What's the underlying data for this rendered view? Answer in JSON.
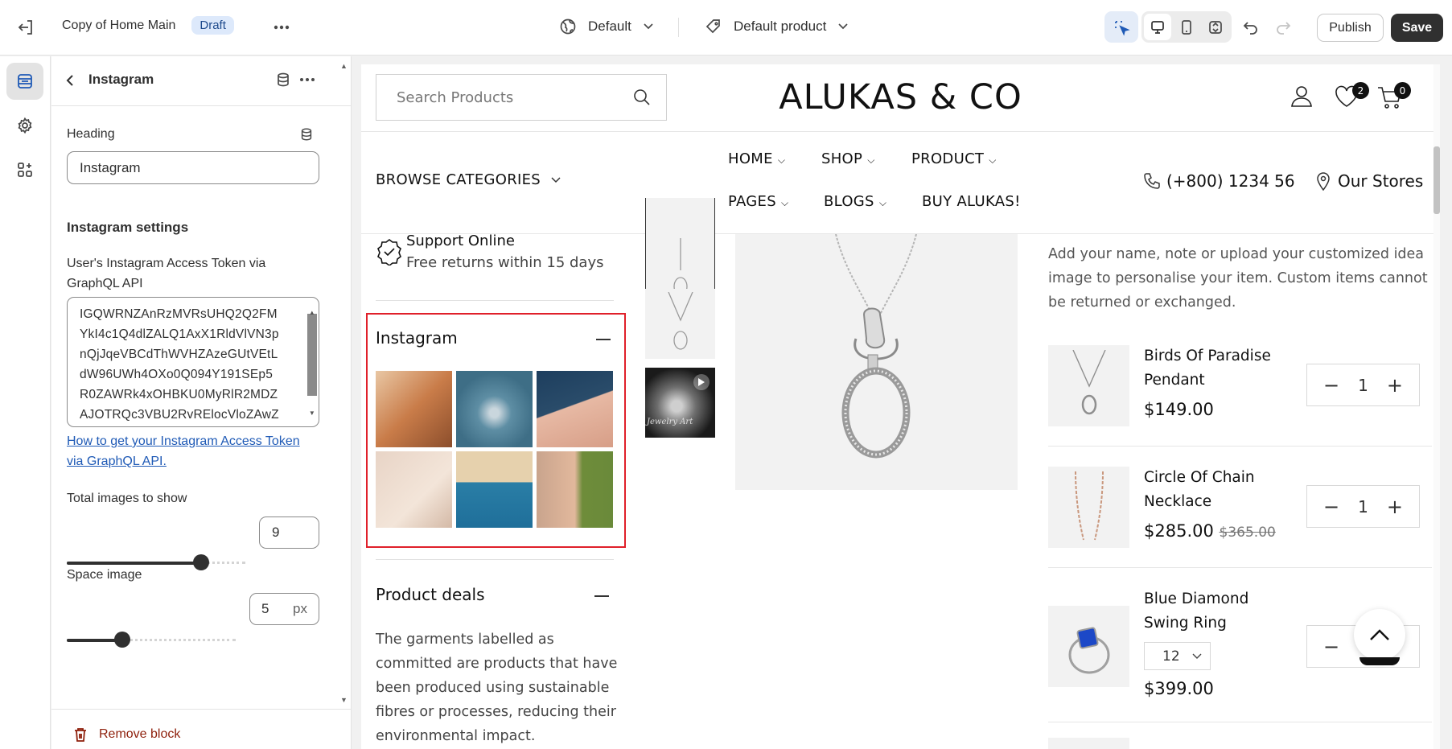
{
  "topbar": {
    "page_name": "Copy of Home Main",
    "status_badge": "Draft",
    "theme_select": "Default",
    "product_select": "Default product",
    "publish_label": "Publish",
    "save_label": "Save"
  },
  "panel": {
    "title": "Instagram",
    "heading_label": "Heading",
    "heading_value": "Instagram",
    "section_title": "Instagram settings",
    "token_label": "User's Instagram Access Token via GraphQL API",
    "token_lines": [
      "IGQWRNZAnRzMVRsUHQ2Q2FM",
      "YkI4c1Q4dlZALQ1AxX1RldVlVN3p",
      "nQjJqeVBCdThWVHZAzeGUtVEtL",
      "dW96UWh4OXo0Q094Y191SEp5",
      "R0ZAWRk4xOHBKU0MyRlR2MDZ",
      "AJOTRQc3VBU2RvRElocVloZAwZ"
    ],
    "token_link": "How to get your Instagram Access Token via GraphQL API.",
    "total_images_label": "Total images to show",
    "total_images_value": "9",
    "total_images_slider": 0.75,
    "space_image_label": "Space image",
    "space_image_value": "5",
    "space_image_unit": "px",
    "space_image_slider": 0.33,
    "remove_block_label": "Remove block"
  },
  "store": {
    "search_placeholder": "Search Products",
    "logo": "ALUKAS & CO",
    "wishlist_count": "2",
    "cart_count": "0",
    "browse_categories": "BROWSE CATEGORIES",
    "menu_row1": [
      "HOME",
      "SHOP",
      "PRODUCT"
    ],
    "menu_row2": [
      "PAGES",
      "BLOGS",
      "BUY ALUKAS!"
    ],
    "phone": "(+800) 1234 56",
    "our_stores": "Our Stores",
    "support_title": "Support Online",
    "support_sub": "Free returns within 15 days",
    "instagram_heading": "Instagram",
    "product_deals_heading": "Product deals",
    "product_deals_text": [
      "The garments labelled as",
      "committed are products that have",
      "been produced using sustainable",
      "fibres or processes, reducing their",
      "environmental impact."
    ],
    "thumb_caption": "Jewelry Art",
    "custom_text": [
      "Add your name, note or upload your customized idea",
      "image to personalise your item. Custom items cannot",
      "be returned or exchanged."
    ],
    "products": [
      {
        "name1": "Birds Of Paradise",
        "name2": "Pendant",
        "price": "$149.00",
        "old_price": "",
        "qty": "1",
        "size": ""
      },
      {
        "name1": "Circle Of Chain",
        "name2": "Necklace",
        "price": "$285.00",
        "old_price": "$365.00",
        "qty": "1",
        "size": ""
      },
      {
        "name1": "Blue Diamond",
        "name2": "Swing Ring",
        "price": "$399.00",
        "old_price": "",
        "qty": "",
        "size": "12"
      }
    ]
  }
}
